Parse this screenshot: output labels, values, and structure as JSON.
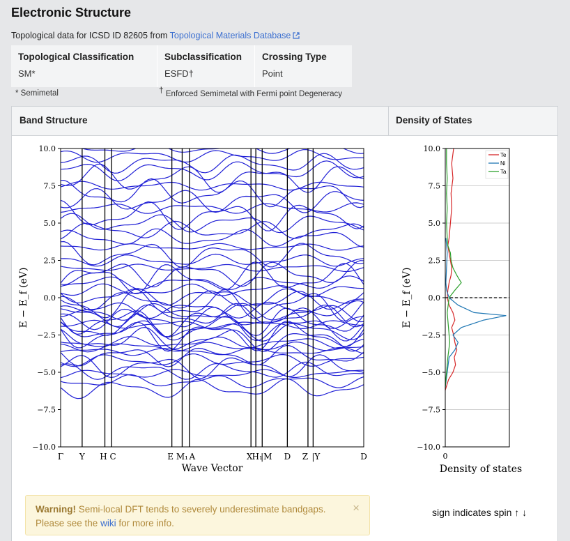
{
  "page": {
    "title": "Electronic Structure",
    "intro_text": "Topological data for ICSD ID 82605 from",
    "intro_link": "Topological Materials Database"
  },
  "classification": {
    "headers": [
      "Topological Classification",
      "Subclassification",
      "Crossing Type"
    ],
    "values": [
      "SM*",
      "ESFD†",
      "Point"
    ],
    "note_semimetal": "* Semimetal",
    "note_esfd_mark": "†",
    "note_esfd": "Enforced Semimetal with Fermi point Degeneracy"
  },
  "panel": {
    "band_header": "Band Structure",
    "dos_header": "Density of States"
  },
  "warning": {
    "strong": "Warning!",
    "text1": "Semi-local DFT tends to severely underestimate bandgaps.",
    "text2": "Please see the",
    "link": "wiki",
    "text3": "for more info.",
    "close": "×"
  },
  "spin_note": "sign indicates spin ↑ ↓",
  "colors": {
    "band_line": "#1f1fd6",
    "te": "#d62728",
    "ni": "#1f77b4",
    "ta": "#2ca02c",
    "link": "#3b6fd0"
  },
  "chart_data": [
    {
      "type": "line",
      "name": "band-structure",
      "xlabel": "Wave Vector",
      "ylabel": "E − E_f (eV)",
      "ylim": [
        -10,
        10
      ],
      "yticks": [
        "10.0",
        "7.5",
        "5.0",
        "2.5",
        "0.0",
        "−2.5",
        "−5.0",
        "−7.5",
        "−10.0"
      ],
      "high_symmetry_labels": [
        "Γ",
        "Y",
        "H",
        "C",
        "E",
        "M₁",
        "A",
        "X",
        "H₁",
        "|M",
        "D",
        "Z",
        "|Y",
        "D"
      ],
      "segments": 12,
      "band_energies_sampled": [
        -6.1,
        -5.6,
        -5.1,
        -4.9,
        -4.6,
        -4.2,
        -3.9,
        -3.6,
        -3.3,
        -3.0,
        -2.8,
        -2.5,
        -2.2,
        -2.0,
        -1.8,
        -1.6,
        -1.4,
        -1.2,
        -1.0,
        -0.8,
        -0.5,
        -0.2,
        0.1,
        0.5,
        1.0,
        1.3,
        1.6,
        2.0,
        2.5,
        2.9,
        3.4,
        4.0,
        4.5,
        5.0,
        5.5,
        6.0,
        6.5,
        7.0,
        7.5,
        8.0,
        8.5,
        9.0,
        9.5,
        10.0
      ]
    },
    {
      "type": "line",
      "name": "density-of-states",
      "xlabel": "Density of states",
      "ylabel": "E − E_f (eV)",
      "ylim": [
        -10,
        10
      ],
      "yticks": [
        "10.0",
        "7.5",
        "5.0",
        "2.5",
        "0.0",
        "−2.5",
        "−5.0",
        "−7.5",
        "−10.0"
      ],
      "xtick": "0",
      "legend": [
        "Te",
        "Ni",
        "Ta"
      ],
      "legend_position": "top-right",
      "series": [
        {
          "name": "Te",
          "energy": [
            -6.2,
            -5.5,
            -5.0,
            -4.5,
            -4.0,
            -3.5,
            -3.0,
            -2.5,
            -2.0,
            -1.5,
            -1.0,
            -0.5,
            0,
            0.5,
            1.0,
            1.5,
            2.0,
            2.5,
            3.0,
            3.5,
            4.0,
            5.0,
            6.0,
            7.0,
            8.0,
            9.0,
            10.0
          ],
          "dos": [
            0.0,
            0.5,
            1.2,
            1.6,
            1.4,
            1.8,
            1.5,
            1.3,
            1.0,
            1.5,
            1.2,
            0.6,
            0.3,
            0.4,
            0.6,
            0.9,
            1.0,
            0.8,
            0.6,
            0.4,
            0.6,
            0.8,
            1.0,
            0.9,
            1.2,
            1.0,
            1.3
          ]
        },
        {
          "name": "Ni",
          "energy": [
            -6.0,
            -5.0,
            -4.0,
            -3.5,
            -3.0,
            -2.5,
            -2.0,
            -1.5,
            -1.2,
            -1.0,
            -0.5,
            0,
            0.5,
            1.0,
            2.0,
            3.0,
            4.0
          ],
          "dos": [
            0.0,
            0.3,
            0.6,
            1.5,
            2.0,
            1.2,
            2.5,
            6.0,
            9.5,
            4.5,
            2.0,
            0.6,
            0.2,
            0.1,
            0.2,
            0.3,
            0.1
          ]
        },
        {
          "name": "Ta",
          "energy": [
            -6.0,
            -5.0,
            -4.0,
            -3.0,
            -2.0,
            -1.0,
            0,
            0.5,
            1.0,
            1.5,
            2.0,
            2.5,
            3.0,
            3.5,
            4.0,
            5.0,
            6.0,
            7.0,
            8.0,
            9.0,
            10.0
          ],
          "dos": [
            0.0,
            0.2,
            0.4,
            0.7,
            0.5,
            0.3,
            0.6,
            1.5,
            2.5,
            1.8,
            1.2,
            0.9,
            0.8,
            0.4,
            0.3,
            0.2,
            0.3,
            0.2,
            0.3,
            0.2,
            0.2
          ]
        }
      ]
    }
  ]
}
